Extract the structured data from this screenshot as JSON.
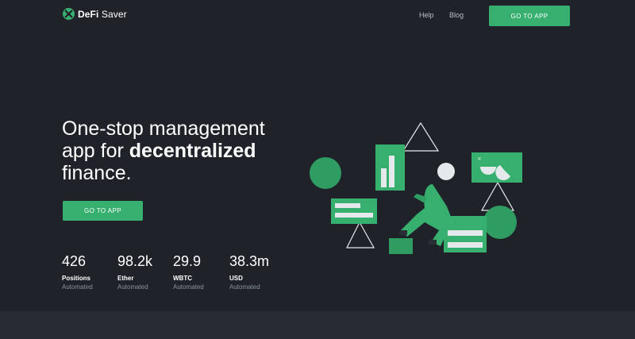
{
  "header": {
    "logo": {
      "brand_bold": "DeFi",
      "brand_rest": " Saver",
      "icon": "defi-saver-logo-icon"
    },
    "nav": [
      {
        "label": "Help"
      },
      {
        "label": "Blog"
      }
    ],
    "cta_label": "GO TO APP"
  },
  "hero": {
    "title_line_1": "One-stop management",
    "title_pre_bold": "app for ",
    "title_bold": "decentralized",
    "title_line_3": "finance.",
    "cta_label": "GO TO APP"
  },
  "stats": [
    {
      "value": "426",
      "label": "Positions",
      "sub": "Automated"
    },
    {
      "value": "98.2k",
      "label": "Ether",
      "sub": "Automated"
    },
    {
      "value": "29.9",
      "label": "WBTC",
      "sub": "Automated"
    },
    {
      "value": "38.3m",
      "label": "USD",
      "sub": "Automated"
    }
  ],
  "colors": {
    "background": "#1f2329",
    "accent": "#37b06f",
    "text": "#ffffff",
    "muted": "#8a929c"
  }
}
